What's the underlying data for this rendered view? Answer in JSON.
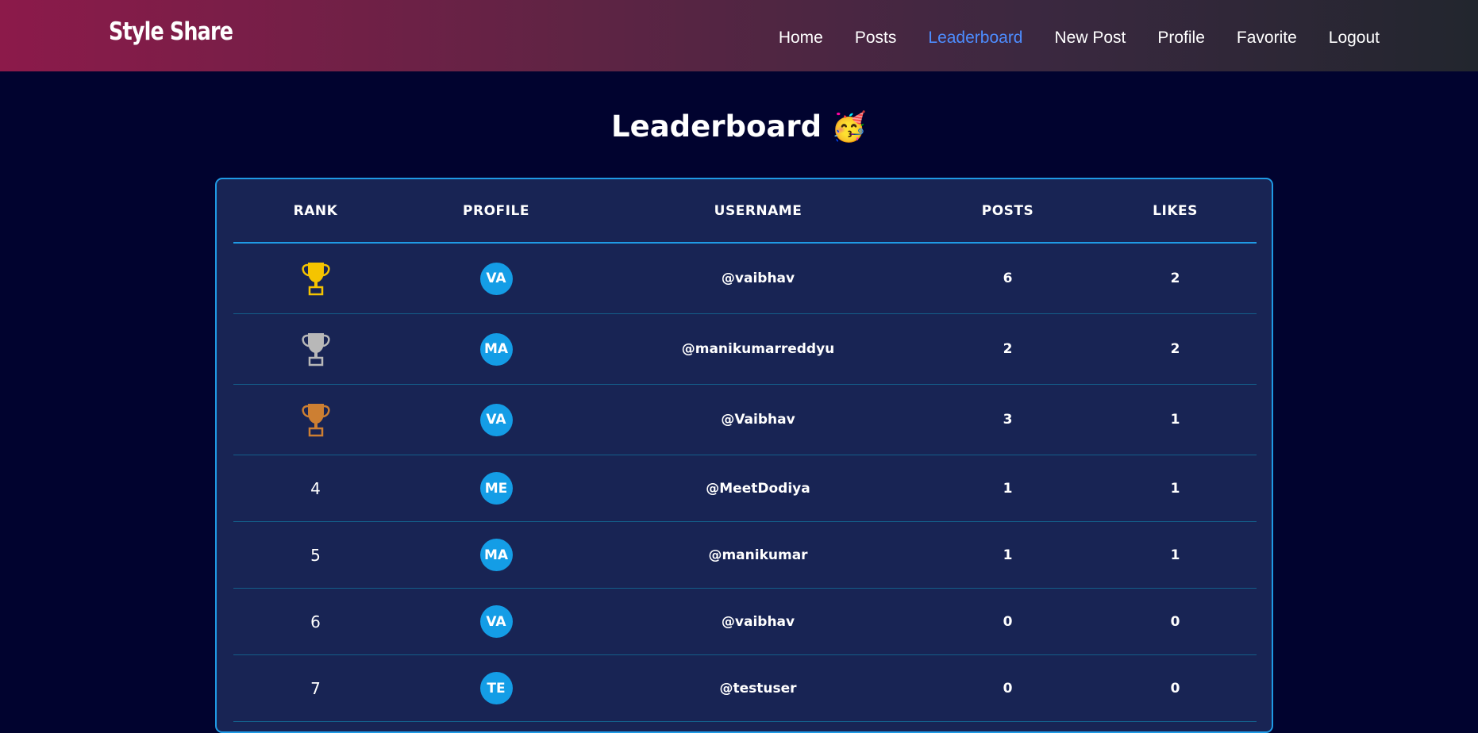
{
  "navbar": {
    "brand": "Style Share",
    "links": [
      {
        "label": "Home",
        "active": false
      },
      {
        "label": "Posts",
        "active": false
      },
      {
        "label": "Leaderboard",
        "active": true
      },
      {
        "label": "New Post",
        "active": false
      },
      {
        "label": "Profile",
        "active": false
      },
      {
        "label": "Favorite",
        "active": false
      },
      {
        "label": "Logout",
        "active": false
      }
    ],
    "active_color": "#4d8dff"
  },
  "page": {
    "title": "Leaderboard",
    "title_emoji": "🥳"
  },
  "table": {
    "headers": {
      "rank": "RANK",
      "profile": "PROFILE",
      "username": "USERNAME",
      "posts": "POSTS",
      "likes": "LIKES"
    },
    "rows": [
      {
        "rank": "1",
        "rank_icon": "trophy-gold-icon",
        "initials": "VA",
        "username": "@vaibhav",
        "posts": "6",
        "likes": "2"
      },
      {
        "rank": "2",
        "rank_icon": "trophy-silver-icon",
        "initials": "MA",
        "username": "@manikumarreddyu",
        "posts": "2",
        "likes": "2"
      },
      {
        "rank": "3",
        "rank_icon": "trophy-bronze-icon",
        "initials": "VA",
        "username": "@Vaibhav",
        "posts": "3",
        "likes": "1"
      },
      {
        "rank": "4",
        "rank_icon": "",
        "initials": "ME",
        "username": "@MeetDodiya",
        "posts": "1",
        "likes": "1"
      },
      {
        "rank": "5",
        "rank_icon": "",
        "initials": "MA",
        "username": "@manikumar",
        "posts": "1",
        "likes": "1"
      },
      {
        "rank": "6",
        "rank_icon": "",
        "initials": "VA",
        "username": "@vaibhav",
        "posts": "0",
        "likes": "0"
      },
      {
        "rank": "7",
        "rank_icon": "",
        "initials": "TE",
        "username": "@testuser",
        "posts": "0",
        "likes": "0"
      }
    ]
  },
  "colors": {
    "background": "#01032f",
    "card": "#182454",
    "accent": "#1f9ae5",
    "avatar": "#149de6",
    "gold": "#f5c400",
    "silver": "#b8b8b8",
    "bronze": "#cd7f32"
  }
}
